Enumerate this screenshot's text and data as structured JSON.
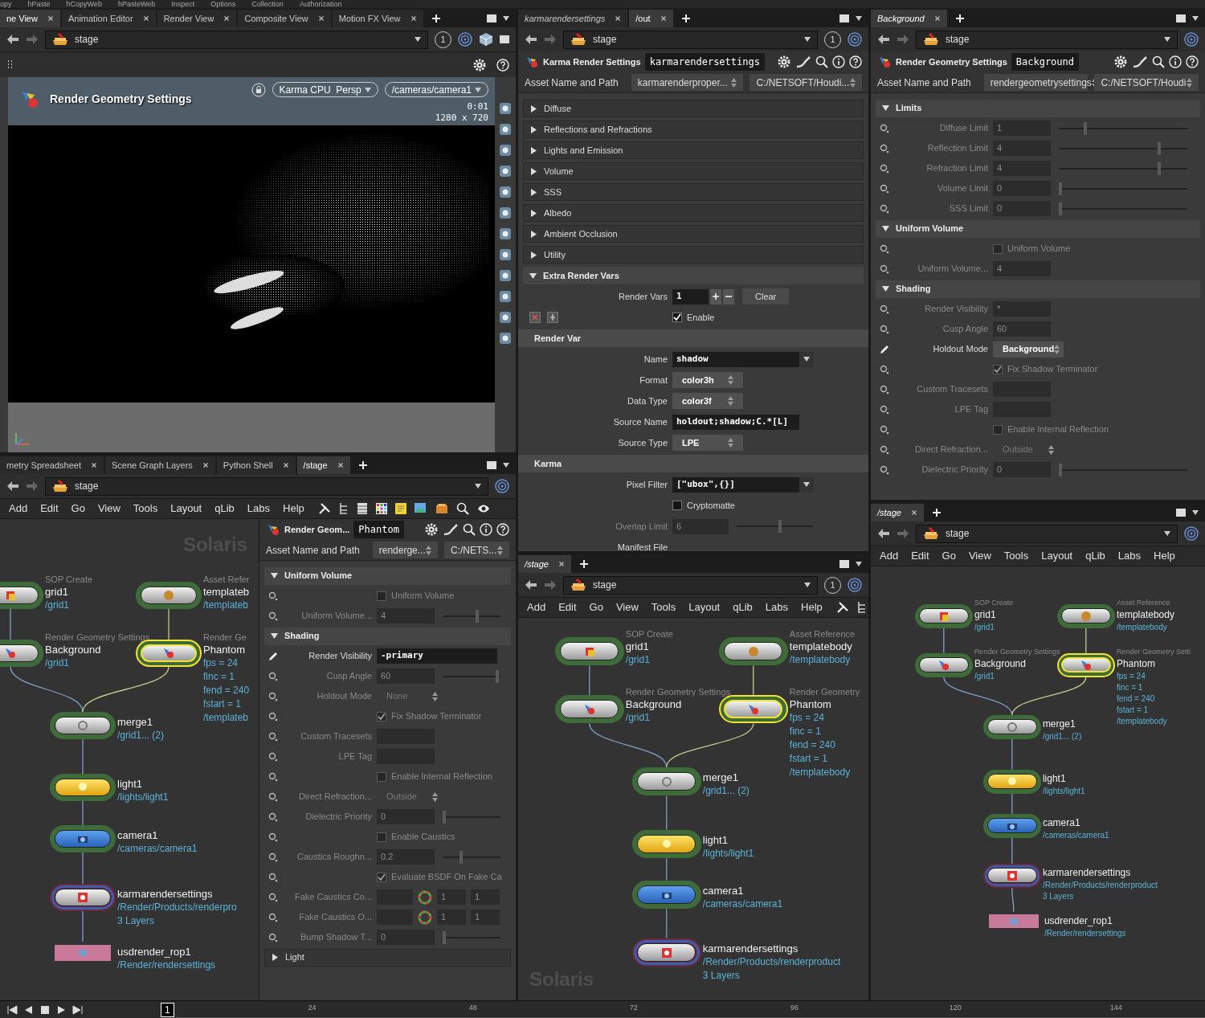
{
  "top_menu": [
    "opy",
    "hPaste",
    "hCopyWeb",
    "hPasteWeb",
    "Inspect",
    "Options",
    "Collection",
    "Authorization"
  ],
  "left_column": {
    "viewer": {
      "tabs": [
        {
          "label": "ne View",
          "selected": true,
          "follows_selection": false
        },
        {
          "label": "Animation Editor",
          "selected": false,
          "follows_selection": false
        },
        {
          "label": "Render View",
          "selected": false,
          "follows_selection": false
        },
        {
          "label": "Composite View",
          "selected": false,
          "follows_selection": false
        },
        {
          "label": "Motion FX View",
          "selected": false,
          "follows_selection": false
        }
      ],
      "path": "stage",
      "pin_group": "1",
      "viewport": {
        "title": "Render Geometry Settings",
        "renderer": "Karma CPU  Persp",
        "camera": "/cameras/camera1",
        "time": "0:01",
        "resolution": "1280 x 720"
      }
    },
    "network": {
      "tabs": [
        {
          "label": "metry Spreadsheet",
          "selected": false,
          "follows_selection": false
        },
        {
          "label": "Scene Graph Layers",
          "selected": false,
          "follows_selection": false
        },
        {
          "label": "Python Shell",
          "selected": false,
          "follows_selection": false
        },
        {
          "label": "/stage",
          "selected": true,
          "follows_selection": false
        }
      ],
      "path": "stage",
      "menu": [
        "Add",
        "Edit",
        "Go",
        "View",
        "Tools",
        "Layout",
        "qLib",
        "Labs",
        "Help"
      ],
      "watermark": "Solaris",
      "nodes": [
        {
          "kind": "sop_create",
          "type_label": "SOP Create",
          "name": "grid1",
          "details": [
            "/grid1"
          ],
          "display": false
        },
        {
          "kind": "asset_ref",
          "type_label": "Asset Refer",
          "name": "templateb",
          "details": [
            "/templateb"
          ],
          "display": false
        },
        {
          "kind": "geo_settings",
          "type_label": "Render Geometry Settings",
          "name": "Background",
          "details": [
            "/grid1"
          ],
          "display": false
        },
        {
          "kind": "geo_settings",
          "type_label": "Render Ge",
          "name": "Phantom",
          "details": [
            "fps = 24",
            "finc = 1",
            "fend = 240",
            "fstart = 1",
            "/templateb"
          ],
          "display": true
        },
        {
          "kind": "merge",
          "name": "merge1",
          "details": [
            "/grid1... (2)"
          ],
          "display": false
        },
        {
          "kind": "light",
          "name": "light1",
          "details": [
            "/lights/light1"
          ],
          "display": false
        },
        {
          "kind": "camera",
          "name": "camera1",
          "details": [
            "/cameras/camera1"
          ],
          "display": false
        },
        {
          "kind": "karma",
          "name": "karmarendersettings",
          "details": [
            "/Render/Products/renderpro",
            "3 Layers"
          ],
          "display": false
        },
        {
          "kind": "rop",
          "name": "usdrender_rop1",
          "details": [
            "/Render/rendersettings"
          ]
        }
      ],
      "parameters": {
        "node_type": "Render Geom...",
        "node_name": "Phantom",
        "asset_label": "Asset Name and Path",
        "asset_name": "renderge...",
        "asset_path": "C:/NETS...",
        "rows": [
          {
            "kind": "folder",
            "label": "Uniform Volume",
            "expanded": true
          },
          {
            "kind": "toggle",
            "label": "Uniform Volume",
            "checked": false,
            "disabled": true,
            "overridden": false
          },
          {
            "kind": "slider",
            "label": "Uniform Volume...",
            "value": "4",
            "level": 0.6,
            "disabled": true,
            "overridden": false
          },
          {
            "kind": "folder",
            "label": "Shading",
            "expanded": true
          },
          {
            "kind": "text",
            "label": "Render Visibility",
            "value": "-primary",
            "disabled": false,
            "overridden": true
          },
          {
            "kind": "slider",
            "label": "Cusp Angle",
            "value": "60",
            "level": 0.95,
            "disabled": true,
            "overridden": false
          },
          {
            "kind": "menu",
            "label": "Holdout Mode",
            "value": "None",
            "disabled": true,
            "overridden": false
          },
          {
            "kind": "toggle",
            "label": "Fix Shadow Terminator",
            "checked": true,
            "disabled": true,
            "overridden": false
          },
          {
            "kind": "field",
            "label": "Custom Tracesets",
            "disabled": true,
            "overridden": false
          },
          {
            "kind": "field",
            "label": "LPE Tag",
            "disabled": true,
            "overridden": false
          },
          {
            "kind": "toggle",
            "label": "Enable Internal Reflection",
            "checked": false,
            "disabled": true,
            "overridden": false
          },
          {
            "kind": "menu",
            "label": "Direct Refraction...",
            "value": "Outside",
            "disabled": true,
            "overridden": false
          },
          {
            "kind": "slider",
            "label": "Dielectric Priority",
            "value": "0",
            "level": 0,
            "disabled": true,
            "overridden": false
          },
          {
            "kind": "toggle",
            "label": "Enable Caustics",
            "checked": false,
            "disabled": true,
            "overridden": false
          },
          {
            "kind": "slider",
            "label": "Caustics Roughn...",
            "value": "0.2",
            "level": 0.3,
            "disabled": true,
            "overridden": false
          },
          {
            "kind": "toggle",
            "label": "Evaluate BSDF On Fake Ca",
            "checked": true,
            "disabled": true,
            "overridden": false
          },
          {
            "kind": "color",
            "label": "Fake Caustics Co...",
            "values": [
              "1",
              "1"
            ],
            "disabled": true,
            "overridden": false
          },
          {
            "kind": "color",
            "label": "Fake Caustics O...",
            "values": [
              "1",
              "1"
            ],
            "disabled": true,
            "overridden": false
          },
          {
            "kind": "slider",
            "label": "Bump Shadow T...",
            "value": "0",
            "level": 0,
            "disabled": true,
            "overridden": false
          },
          {
            "kind": "folder",
            "label": "Light",
            "expanded": false
          }
        ]
      }
    }
  },
  "middle_column": {
    "parameters": {
      "tabs": [
        {
          "label": "karmarendersettings",
          "selected": false,
          "follows_selection": true
        },
        {
          "label": "/out",
          "selected": true,
          "follows_selection": false
        }
      ],
      "path": "stage",
      "pin_group": "1",
      "node_type": "Karma Render Settings",
      "node_name": "karmarendersettings",
      "asset_label": "Asset Name and Path",
      "asset_name": "karmarenderproper...",
      "asset_path": "C:/NETSOFT/Houdi...",
      "rows": [
        {
          "kind": "folder",
          "label": "Diffuse",
          "expanded": false
        },
        {
          "kind": "folder",
          "label": "Reflections and Refractions",
          "expanded": false
        },
        {
          "kind": "folder",
          "label": "Lights and Emission",
          "expanded": false
        },
        {
          "kind": "folder",
          "label": "Volume",
          "expanded": false
        },
        {
          "kind": "folder",
          "label": "SSS",
          "expanded": false
        },
        {
          "kind": "folder",
          "label": "Albedo",
          "expanded": false
        },
        {
          "kind": "folder",
          "label": "Ambient Occlusion",
          "expanded": false
        },
        {
          "kind": "folder",
          "label": "Utility",
          "expanded": false
        },
        {
          "kind": "folder",
          "label": "Extra Render Vars",
          "expanded": true
        },
        {
          "kind": "multiparm",
          "label": "Render Vars",
          "value": "1",
          "button": "Clear"
        },
        {
          "kind": "instance_toggle",
          "label": "Enable",
          "checked": true,
          "disabled": false
        },
        {
          "kind": "section",
          "label": "Render Var"
        },
        {
          "kind": "text",
          "label": "Name",
          "value": "shadow",
          "dropdown": true,
          "disabled": false
        },
        {
          "kind": "menu",
          "label": "Format",
          "value": "color3h",
          "disabled": false
        },
        {
          "kind": "menu",
          "label": "Data Type",
          "value": "color3f",
          "disabled": false
        },
        {
          "kind": "text",
          "label": "Source Name",
          "value": "holdout;shadow;C.*[L]",
          "disabled": false
        },
        {
          "kind": "menu",
          "label": "Source Type",
          "value": "LPE",
          "disabled": false
        },
        {
          "kind": "section",
          "label": "Karma"
        },
        {
          "kind": "text",
          "label": "Pixel Filter",
          "value": "[\"ubox\",{}]",
          "dropdown": true,
          "disabled": false
        },
        {
          "kind": "toggle",
          "label": "Cryptomatte",
          "checked": false,
          "disabled": false
        },
        {
          "kind": "slider",
          "label": "Overlap Limit",
          "value": "6",
          "level": 0.57,
          "disabled": true
        },
        {
          "kind": "label",
          "label": "Manifest File"
        }
      ]
    },
    "network": {
      "tabs": [
        {
          "label": "/stage",
          "selected": true,
          "follows_selection": true
        }
      ],
      "path": "stage",
      "pin_group": "1",
      "menu": [
        "Add",
        "Edit",
        "Go",
        "View",
        "Tools",
        "Layout",
        "qLib",
        "Labs",
        "Help"
      ],
      "watermark": "Solaris",
      "nodes": [
        {
          "kind": "sop_create",
          "type_label": "SOP Create",
          "name": "grid1",
          "details": [
            "/grid1"
          ],
          "display": false
        },
        {
          "kind": "asset_ref",
          "type_label": "Asset Reference",
          "name": "templatebody",
          "details": [
            "/templatebody"
          ],
          "display": false
        },
        {
          "kind": "geo_settings",
          "type_label": "Render Geometry Settings",
          "name": "Background",
          "details": [
            "/grid1"
          ],
          "display": false
        },
        {
          "kind": "geo_settings",
          "type_label": "Render Geometry",
          "name": "Phantom",
          "details": [
            "fps = 24",
            "finc = 1",
            "fend = 240",
            "fstart = 1",
            "/templatebody"
          ],
          "display": true
        },
        {
          "kind": "merge",
          "name": "merge1",
          "details": [
            "/grid1... (2)"
          ],
          "display": false
        },
        {
          "kind": "light",
          "name": "light1",
          "details": [
            "/lights/light1"
          ],
          "display": false
        },
        {
          "kind": "camera",
          "name": "camera1",
          "details": [
            "/cameras/camera1"
          ],
          "display": false
        },
        {
          "kind": "karma",
          "name": "karmarendersettings",
          "details": [
            "/Render/Products/renderproduct",
            "3 Layers"
          ],
          "display": false
        }
      ]
    }
  },
  "right_column": {
    "parameters": {
      "tabs": [
        {
          "label": "Background",
          "selected": true,
          "follows_selection": true
        }
      ],
      "path": "stage",
      "node_type": "Render Geometry Settings",
      "node_name": "Background",
      "asset_label": "Asset Name and Path",
      "asset_name": "rendergeometrysettings",
      "asset_path": "C:/NETSOFT/Houdi",
      "rows": [
        {
          "kind": "folder",
          "label": "Limits",
          "expanded": true
        },
        {
          "kind": "slider",
          "label": "Diffuse Limit",
          "value": "1",
          "level": 0.2,
          "disabled": true,
          "overridden": false
        },
        {
          "kind": "slider",
          "label": "Reflection Limit",
          "value": "4",
          "level": 0.8,
          "disabled": true,
          "overridden": false
        },
        {
          "kind": "slider",
          "label": "Refraction Limit",
          "value": "4",
          "level": 0.8,
          "disabled": true,
          "overridden": false
        },
        {
          "kind": "slider",
          "label": "Volume Limit",
          "value": "0",
          "level": 0,
          "disabled": true,
          "overridden": false
        },
        {
          "kind": "slider",
          "label": "SSS Limit",
          "value": "0",
          "level": 0,
          "disabled": true,
          "overridden": false
        },
        {
          "kind": "folder",
          "label": "Uniform Volume",
          "expanded": true
        },
        {
          "kind": "toggle",
          "label": "Uniform Volume",
          "checked": false,
          "disabled": true,
          "overridden": false
        },
        {
          "kind": "field",
          "label": "Uniform Volume...",
          "value": "4",
          "disabled": true,
          "overridden": false
        },
        {
          "kind": "folder",
          "label": "Shading",
          "expanded": true
        },
        {
          "kind": "field",
          "label": "Render Visibility",
          "value": "*",
          "disabled": true,
          "overridden": false
        },
        {
          "kind": "field",
          "label": "Cusp Angle",
          "value": "60",
          "disabled": true,
          "overridden": false
        },
        {
          "kind": "menu",
          "label": "Holdout Mode",
          "value": "Background",
          "disabled": false,
          "overridden": true
        },
        {
          "kind": "toggle",
          "label": "Fix Shadow Terminator",
          "checked": true,
          "disabled": true,
          "overridden": false
        },
        {
          "kind": "field",
          "label": "Custom Tracesets",
          "disabled": true,
          "overridden": false
        },
        {
          "kind": "field",
          "label": "LPE Tag",
          "disabled": true,
          "overridden": false
        },
        {
          "kind": "toggle",
          "label": "Enable Internal Reflection",
          "checked": false,
          "disabled": true,
          "overridden": false
        },
        {
          "kind": "menu",
          "label": "Direct Refraction...",
          "value": "Outside",
          "disabled": true,
          "overridden": false
        },
        {
          "kind": "slider",
          "label": "Dielectric Priority",
          "value": "0",
          "level": 0,
          "disabled": true,
          "overridden": false
        }
      ]
    },
    "network": {
      "tabs": [
        {
          "label": "/stage",
          "selected": true,
          "follows_selection": true
        }
      ],
      "path": "stage",
      "menu": [
        "Add",
        "Edit",
        "Go",
        "View",
        "Tools",
        "Layout",
        "qLib",
        "Labs",
        "Help"
      ],
      "nodes": [
        {
          "kind": "sop_create",
          "type_label": "SOP Create",
          "name": "grid1",
          "details": [
            "/grid1"
          ],
          "display": false
        },
        {
          "kind": "asset_ref",
          "type_label": "Asset Reference",
          "name": "templatebody",
          "details": [
            "/templatebody"
          ],
          "display": false
        },
        {
          "kind": "geo_settings",
          "type_label": "Render Geometry Settings",
          "name": "Background",
          "details": [
            "/grid1"
          ],
          "display": false
        },
        {
          "kind": "geo_settings",
          "type_label": "Render Geometry Setti",
          "name": "Phantom",
          "details": [
            "fps = 24",
            "finc = 1",
            "fend = 240",
            "fstart = 1",
            "/templatebody"
          ],
          "display": true
        },
        {
          "kind": "merge",
          "name": "merge1",
          "details": [
            "/grid1... (2)"
          ],
          "display": false
        },
        {
          "kind": "light",
          "name": "light1",
          "details": [
            "/lights/light1"
          ],
          "display": false
        },
        {
          "kind": "camera",
          "name": "camera1",
          "details": [
            "/cameras/camera1"
          ],
          "display": false
        },
        {
          "kind": "karma",
          "name": "karmarendersettings",
          "details": [
            "/Render/Products/renderproduct",
            "3 Layers"
          ],
          "display": false
        },
        {
          "kind": "rop",
          "name": "usdrender_rop1",
          "details": [
            "/Render/rendersettings"
          ]
        }
      ]
    }
  },
  "timeline": {
    "current_frame": "1",
    "ticks": [
      "24",
      "48",
      "72",
      "96",
      "120",
      "144"
    ]
  }
}
